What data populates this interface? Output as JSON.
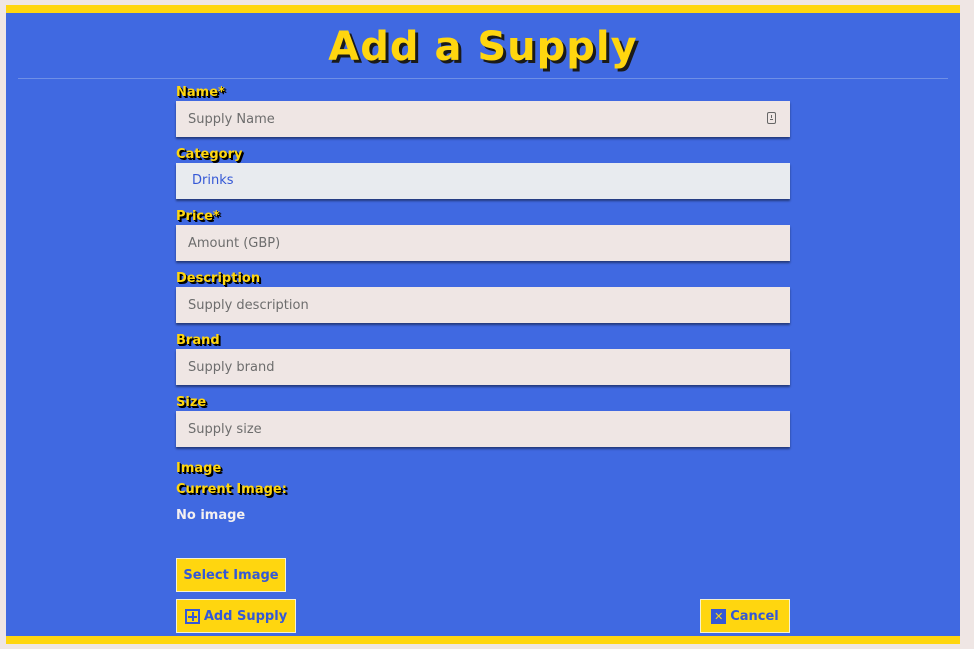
{
  "page": {
    "title": "Add a Supply"
  },
  "form": {
    "name": {
      "label": "Name*",
      "placeholder": "Supply Name",
      "value": ""
    },
    "category": {
      "label": "Category",
      "value": "Drinks"
    },
    "price": {
      "label": "Price*",
      "placeholder": "Amount (GBP)",
      "value": ""
    },
    "description": {
      "label": "Description",
      "placeholder": "Supply description",
      "value": ""
    },
    "brand": {
      "label": "Brand",
      "placeholder": "Supply brand",
      "value": ""
    },
    "size": {
      "label": "Size",
      "placeholder": "Supply size",
      "value": ""
    },
    "image": {
      "label": "Image",
      "current_label": "Current Image:",
      "current_value": "No image",
      "select_button": "Select Image"
    }
  },
  "actions": {
    "add_label": "Add Supply",
    "add_icon": "plus-square-icon",
    "cancel_label": "Cancel",
    "cancel_icon": "close-icon"
  },
  "colors": {
    "background": "#4069e1",
    "accent": "#ffd60f",
    "button_text": "#3458d6"
  }
}
